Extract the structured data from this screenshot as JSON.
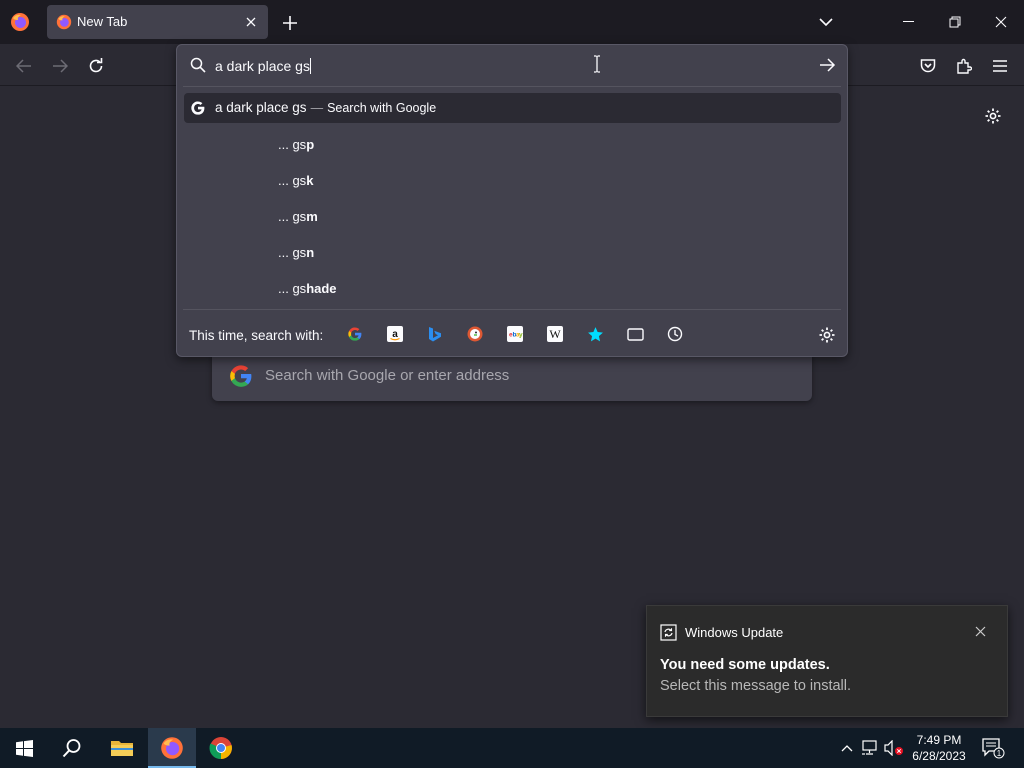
{
  "browser": {
    "tab_title": "New Tab"
  },
  "urlbar": {
    "input_value": "a dark place gs",
    "top_result": {
      "query": "a dark place gs",
      "separator": "—",
      "action": "Search with Google"
    },
    "suggestions": [
      {
        "prefix": "... gs",
        "completion": "p"
      },
      {
        "prefix": "... gs",
        "completion": "k"
      },
      {
        "prefix": "... gs",
        "completion": "m"
      },
      {
        "prefix": "... gs",
        "completion": "n"
      },
      {
        "prefix": "... gs",
        "completion": "hade"
      }
    ],
    "oneoff_label": "This time, search with:",
    "oneoff_engines": [
      "google-icon",
      "amazon-icon",
      "bing-icon",
      "duckduckgo-icon",
      "ebay-icon",
      "wikipedia-icon",
      "bookmarks-star-icon",
      "tabs-icon",
      "history-icon"
    ]
  },
  "newtab": {
    "search_placeholder": "Search with Google or enter address"
  },
  "notification": {
    "app_name": "Windows Update",
    "title": "You need some updates.",
    "body": "Select this message to install."
  },
  "taskbar": {
    "time": "7:49 PM",
    "date": "6/28/2023",
    "notification_count": "1"
  },
  "colors": {
    "toolbar": "#1c1b22",
    "content": "#2b2a33",
    "popup": "#42414d",
    "taskbar": "#101b26",
    "accent": "#76b9ed"
  }
}
